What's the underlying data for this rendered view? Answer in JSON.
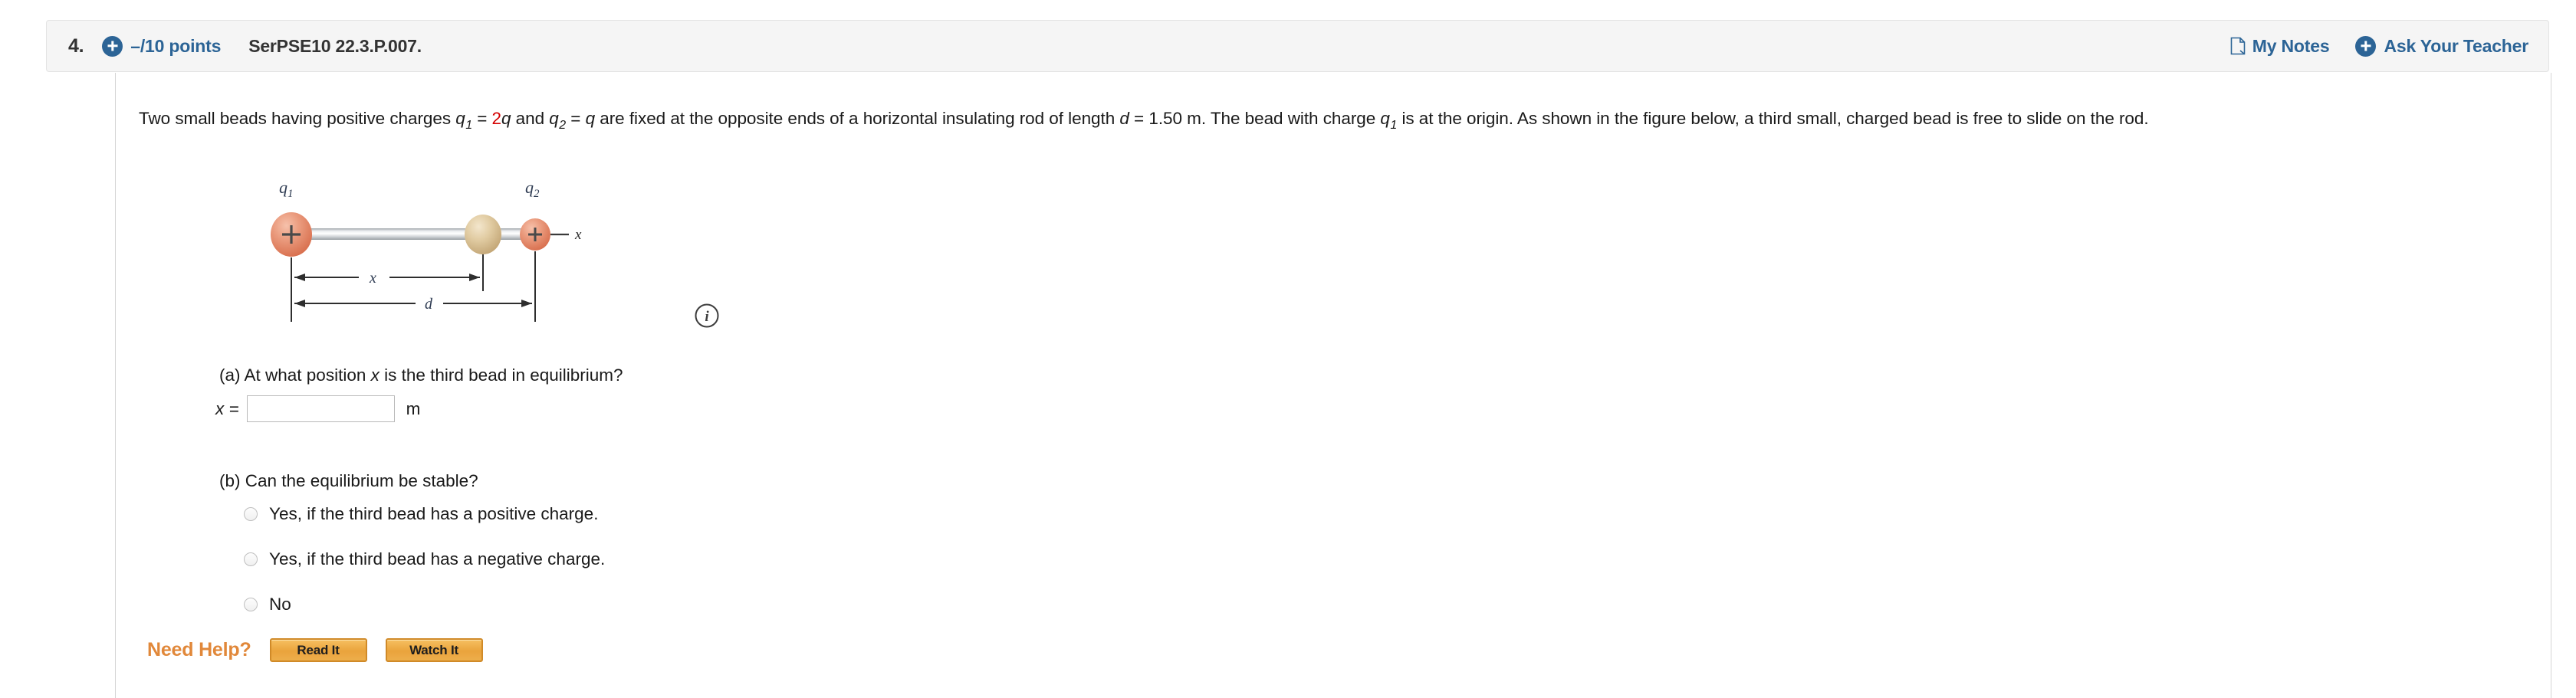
{
  "header": {
    "question_number": "4.",
    "plus_icon": "plus-circle-icon",
    "points": "–/10 points",
    "problem_code": "SerPSE10 22.3.P.007.",
    "my_notes_label": "My Notes",
    "my_notes_icon": "note-page-icon",
    "ask_teacher_label": "Ask Your Teacher",
    "ask_teacher_icon": "plus-circle-icon"
  },
  "problem": {
    "text_part_1": "Two small beads having positive charges ",
    "q1_sym": "q",
    "q1_sub": "1",
    "eq1": " = ",
    "charge1_coef": "2",
    "charge1_var": "q",
    "text_and": " and ",
    "q2_sym": "q",
    "q2_sub": "2",
    "eq2": " = ",
    "charge2_var": "q",
    "text_part_2": " are fixed at the opposite ends of a horizontal insulating rod of length ",
    "d_sym": "d",
    "d_value": " = 1.50 m. The bead with charge ",
    "q3_sym": "q",
    "q3_sub": "1",
    "text_part_3": " is at the origin. As shown in the figure below, a third small, charged bead is free to slide on the rod."
  },
  "figure": {
    "label_q1": "q",
    "label_q1_sub": "1",
    "label_q2": "q",
    "label_q2_sub": "2",
    "label_axis": "x",
    "label_x_dim": "x",
    "label_d_dim": "d",
    "bead_charge_sign": "+",
    "info_icon": "info-circle-icon",
    "colors": {
      "charged_bead": "#e58b6e",
      "neutral_bead": "#ddc49a",
      "rod": "#c9ccce",
      "line": "#3a3a3a"
    }
  },
  "part_a": {
    "question": "(a) At what position x is the third bead in equilibrium?",
    "question_prefix": "(a) At what position ",
    "question_var": "x",
    "question_suffix": " is the third bead in equilibrium?",
    "answer_label_var": "x",
    "answer_label_eq": " = ",
    "answer_value": "",
    "answer_placeholder": "",
    "unit": "m"
  },
  "part_b": {
    "question": "(b) Can the equilibrium be stable?",
    "choices": [
      {
        "label": "Yes, if the third bead has a positive charge.",
        "selected": false
      },
      {
        "label": "Yes, if the third bead has a negative charge.",
        "selected": false
      },
      {
        "label": "No",
        "selected": false
      }
    ]
  },
  "need_help": {
    "label": "Need Help?",
    "read_it_label": "Read It",
    "watch_it_label": "Watch It"
  },
  "colors": {
    "accent_blue": "#2c6496",
    "header_bg": "#f5f5f5",
    "header_border": "#e3e3e3",
    "orange": "#e1883a",
    "red": "#d40000"
  }
}
